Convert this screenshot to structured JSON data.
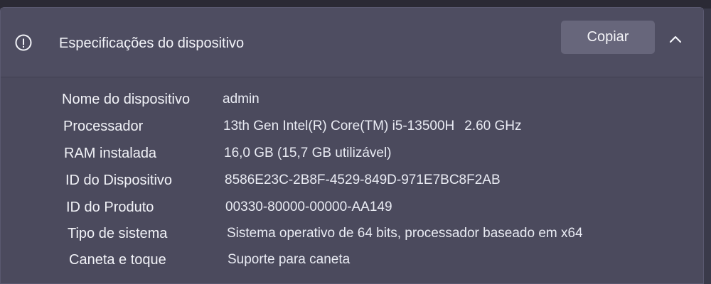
{
  "header": {
    "title": "Especificações do dispositivo",
    "copy_label": "Copiar"
  },
  "specs": [
    {
      "label": "Nome do dispositivo",
      "value": "admin"
    },
    {
      "label": "Processador",
      "value": "13th Gen Intel(R) Core(TM) i5-13500H",
      "value_extra": "2.60 GHz"
    },
    {
      "label": "RAM instalada",
      "value": "16,0 GB (15,7 GB utilizável)"
    },
    {
      "label": "ID do Dispositivo",
      "value": "8586E23C-2B8F-4529-849D-971E7BC8F2AB"
    },
    {
      "label": "ID do Produto",
      "value": "00330-80000-00000-AA149"
    },
    {
      "label": "Tipo de sistema",
      "value": "Sistema operativo de 64 bits, processador baseado em x64"
    },
    {
      "label": "Caneta e toque",
      "value": "Suporte para caneta"
    }
  ],
  "icons": {
    "header": "info-icon",
    "collapse": "chevron-up-icon"
  }
}
